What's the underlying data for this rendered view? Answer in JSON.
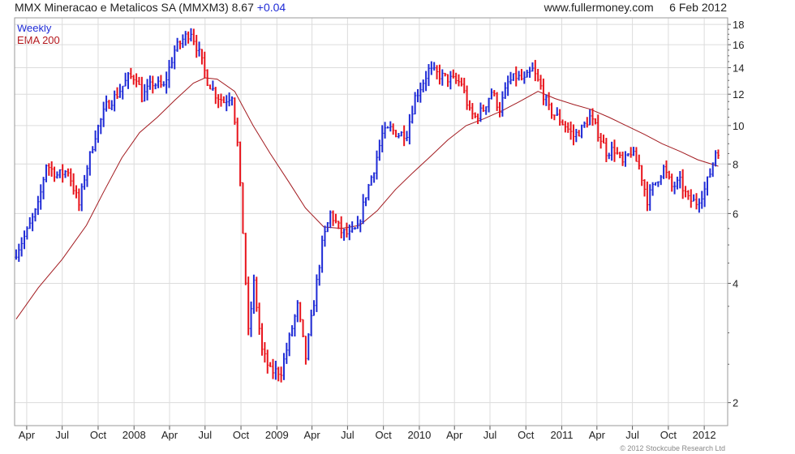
{
  "header": {
    "title": "MMX Mineracao e Metalicos SA (MMXM3)",
    "last_price": "8.67",
    "change": "+0.04",
    "source": "www.fullermoney.com",
    "date": "6 Feb 2012"
  },
  "legend": {
    "series_1": "Weekly",
    "series_2": "EMA 200"
  },
  "copyright": "© 2012 Stockcube Research Ltd",
  "colors": {
    "up_bar": "#1f2bd6",
    "down_bar": "#e8141c",
    "ema_line": "#a21a1f",
    "grid": "#dcdcdc",
    "axis": "#555555"
  },
  "chart_data": {
    "type": "line",
    "y_scale": "log",
    "ylim": [
      1.75,
      18.7
    ],
    "y_ticks": [
      2,
      4,
      6,
      8,
      10,
      12,
      14,
      16,
      18
    ],
    "x_range": [
      "2007-03-01",
      "2012-03-01"
    ],
    "x_ticks": [
      {
        "label": "Apr",
        "date": "2007-04-01"
      },
      {
        "label": "Jul",
        "date": "2007-07-01"
      },
      {
        "label": "Oct",
        "date": "2007-10-01"
      },
      {
        "label": "2008",
        "date": "2008-01-01"
      },
      {
        "label": "Apr",
        "date": "2008-04-01"
      },
      {
        "label": "Jul",
        "date": "2008-07-01"
      },
      {
        "label": "Oct",
        "date": "2008-10-01"
      },
      {
        "label": "2009",
        "date": "2009-01-01"
      },
      {
        "label": "Apr",
        "date": "2009-04-01"
      },
      {
        "label": "Jul",
        "date": "2009-07-01"
      },
      {
        "label": "Oct",
        "date": "2009-10-01"
      },
      {
        "label": "2010",
        "date": "2010-01-01"
      },
      {
        "label": "Apr",
        "date": "2010-04-01"
      },
      {
        "label": "Jul",
        "date": "2010-07-01"
      },
      {
        "label": "Oct",
        "date": "2010-10-01"
      },
      {
        "label": "2011",
        "date": "2011-01-01"
      },
      {
        "label": "Apr",
        "date": "2011-04-01"
      },
      {
        "label": "Jul",
        "date": "2011-07-01"
      },
      {
        "label": "Oct",
        "date": "2011-10-01"
      },
      {
        "label": "2012",
        "date": "2012-01-01"
      }
    ],
    "series": [
      {
        "name": "Weekly",
        "style": "ohlc_bars",
        "points": [
          {
            "date": "2007-03-05",
            "value": 4.8
          },
          {
            "date": "2007-04-02",
            "value": 5.4
          },
          {
            "date": "2007-05-01",
            "value": 6.3
          },
          {
            "date": "2007-05-21",
            "value": 8.0
          },
          {
            "date": "2007-06-18",
            "value": 7.5
          },
          {
            "date": "2007-07-16",
            "value": 7.7
          },
          {
            "date": "2007-08-13",
            "value": 6.3
          },
          {
            "date": "2007-08-27",
            "value": 7.4
          },
          {
            "date": "2007-09-24",
            "value": 9.5
          },
          {
            "date": "2007-10-22",
            "value": 11.2
          },
          {
            "date": "2007-11-19",
            "value": 12.0
          },
          {
            "date": "2007-12-17",
            "value": 13.2
          },
          {
            "date": "2008-01-07",
            "value": 13.3
          },
          {
            "date": "2008-01-21",
            "value": 11.8
          },
          {
            "date": "2008-02-18",
            "value": 12.8
          },
          {
            "date": "2008-03-17",
            "value": 12.5
          },
          {
            "date": "2008-04-14",
            "value": 15.5
          },
          {
            "date": "2008-05-05",
            "value": 16.5
          },
          {
            "date": "2008-05-26",
            "value": 17.3
          },
          {
            "date": "2008-06-16",
            "value": 15.2
          },
          {
            "date": "2008-07-07",
            "value": 13.0
          },
          {
            "date": "2008-07-28",
            "value": 12.0
          },
          {
            "date": "2008-08-18",
            "value": 11.5
          },
          {
            "date": "2008-09-08",
            "value": 12.0
          },
          {
            "date": "2008-09-22",
            "value": 9.0
          },
          {
            "date": "2008-10-06",
            "value": 5.4
          },
          {
            "date": "2008-10-20",
            "value": 3.0
          },
          {
            "date": "2008-11-03",
            "value": 4.0
          },
          {
            "date": "2008-11-24",
            "value": 2.7
          },
          {
            "date": "2008-12-15",
            "value": 2.4
          },
          {
            "date": "2009-01-12",
            "value": 2.4
          },
          {
            "date": "2009-02-02",
            "value": 2.9
          },
          {
            "date": "2009-02-23",
            "value": 3.5
          },
          {
            "date": "2009-03-16",
            "value": 2.6
          },
          {
            "date": "2009-04-06",
            "value": 3.6
          },
          {
            "date": "2009-04-27",
            "value": 5.0
          },
          {
            "date": "2009-05-18",
            "value": 6.0
          },
          {
            "date": "2009-06-15",
            "value": 5.4
          },
          {
            "date": "2009-07-06",
            "value": 5.3
          },
          {
            "date": "2009-07-27",
            "value": 5.5
          },
          {
            "date": "2009-08-17",
            "value": 6.7
          },
          {
            "date": "2009-09-07",
            "value": 7.8
          },
          {
            "date": "2009-09-28",
            "value": 9.5
          },
          {
            "date": "2009-10-19",
            "value": 9.8
          },
          {
            "date": "2009-11-09",
            "value": 9.5
          },
          {
            "date": "2009-11-30",
            "value": 9.6
          },
          {
            "date": "2009-12-21",
            "value": 11.8
          },
          {
            "date": "2010-01-04",
            "value": 12.5
          },
          {
            "date": "2010-01-25",
            "value": 13.8
          },
          {
            "date": "2010-02-15",
            "value": 13.5
          },
          {
            "date": "2010-03-08",
            "value": 13.2
          },
          {
            "date": "2010-03-29",
            "value": 13.0
          },
          {
            "date": "2010-04-19",
            "value": 12.8
          },
          {
            "date": "2010-05-10",
            "value": 10.8
          },
          {
            "date": "2010-05-24",
            "value": 10.5
          },
          {
            "date": "2010-06-14",
            "value": 11.0
          },
          {
            "date": "2010-07-05",
            "value": 12.2
          },
          {
            "date": "2010-07-26",
            "value": 11.0
          },
          {
            "date": "2010-08-16",
            "value": 12.8
          },
          {
            "date": "2010-09-06",
            "value": 13.3
          },
          {
            "date": "2010-09-27",
            "value": 13.0
          },
          {
            "date": "2010-10-18",
            "value": 13.8
          },
          {
            "date": "2010-11-08",
            "value": 12.5
          },
          {
            "date": "2010-11-29",
            "value": 11.0
          },
          {
            "date": "2010-12-20",
            "value": 10.5
          },
          {
            "date": "2011-01-10",
            "value": 10.0
          },
          {
            "date": "2011-01-31",
            "value": 9.4
          },
          {
            "date": "2011-02-21",
            "value": 9.8
          },
          {
            "date": "2011-03-14",
            "value": 10.5
          },
          {
            "date": "2011-04-04",
            "value": 9.6
          },
          {
            "date": "2011-04-25",
            "value": 8.6
          },
          {
            "date": "2011-05-16",
            "value": 8.7
          },
          {
            "date": "2011-06-06",
            "value": 8.0
          },
          {
            "date": "2011-06-27",
            "value": 8.6
          },
          {
            "date": "2011-07-18",
            "value": 7.9
          },
          {
            "date": "2011-08-08",
            "value": 6.5
          },
          {
            "date": "2011-08-29",
            "value": 7.2
          },
          {
            "date": "2011-09-19",
            "value": 7.8
          },
          {
            "date": "2011-10-10",
            "value": 7.0
          },
          {
            "date": "2011-10-31",
            "value": 7.2
          },
          {
            "date": "2011-11-21",
            "value": 6.5
          },
          {
            "date": "2011-12-12",
            "value": 6.4
          },
          {
            "date": "2012-01-02",
            "value": 6.9
          },
          {
            "date": "2012-01-16",
            "value": 7.6
          },
          {
            "date": "2012-01-30",
            "value": 8.6
          },
          {
            "date": "2012-02-06",
            "value": 8.67
          }
        ]
      },
      {
        "name": "EMA 200",
        "style": "line",
        "points": [
          {
            "date": "2007-03-05",
            "value": 3.25
          },
          {
            "date": "2007-05-01",
            "value": 3.9
          },
          {
            "date": "2007-07-01",
            "value": 4.6
          },
          {
            "date": "2007-09-01",
            "value": 5.6
          },
          {
            "date": "2007-10-15",
            "value": 6.8
          },
          {
            "date": "2007-12-01",
            "value": 8.3
          },
          {
            "date": "2008-01-15",
            "value": 9.6
          },
          {
            "date": "2008-03-01",
            "value": 10.5
          },
          {
            "date": "2008-04-15",
            "value": 11.6
          },
          {
            "date": "2008-06-01",
            "value": 12.8
          },
          {
            "date": "2008-07-01",
            "value": 13.2
          },
          {
            "date": "2008-08-01",
            "value": 13.1
          },
          {
            "date": "2008-09-15",
            "value": 12.2
          },
          {
            "date": "2008-11-01",
            "value": 10.0
          },
          {
            "date": "2008-12-15",
            "value": 8.5
          },
          {
            "date": "2009-02-01",
            "value": 7.2
          },
          {
            "date": "2009-03-15",
            "value": 6.2
          },
          {
            "date": "2009-05-01",
            "value": 5.55
          },
          {
            "date": "2009-06-15",
            "value": 5.5
          },
          {
            "date": "2009-08-01",
            "value": 5.6
          },
          {
            "date": "2009-09-15",
            "value": 6.1
          },
          {
            "date": "2009-11-01",
            "value": 6.9
          },
          {
            "date": "2009-12-15",
            "value": 7.6
          },
          {
            "date": "2010-02-01",
            "value": 8.4
          },
          {
            "date": "2010-03-15",
            "value": 9.2
          },
          {
            "date": "2010-05-01",
            "value": 10.0
          },
          {
            "date": "2010-06-15",
            "value": 10.4
          },
          {
            "date": "2010-08-01",
            "value": 10.9
          },
          {
            "date": "2010-09-15",
            "value": 11.5
          },
          {
            "date": "2010-11-01",
            "value": 12.2
          },
          {
            "date": "2010-12-15",
            "value": 11.7
          },
          {
            "date": "2011-02-01",
            "value": 11.3
          },
          {
            "date": "2011-03-15",
            "value": 11.0
          },
          {
            "date": "2011-05-01",
            "value": 10.5
          },
          {
            "date": "2011-06-15",
            "value": 10.0
          },
          {
            "date": "2011-08-01",
            "value": 9.5
          },
          {
            "date": "2011-09-15",
            "value": 9.0
          },
          {
            "date": "2011-11-01",
            "value": 8.6
          },
          {
            "date": "2011-12-15",
            "value": 8.2
          },
          {
            "date": "2012-02-06",
            "value": 7.9
          }
        ]
      }
    ],
    "grid": true,
    "legend_position": "top-left"
  }
}
